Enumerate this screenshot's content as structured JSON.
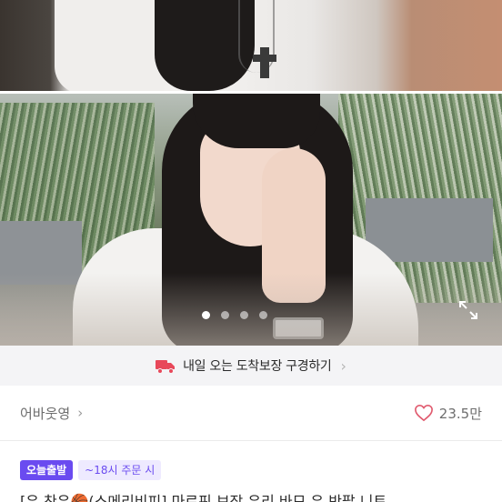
{
  "gallery": {
    "dots_total": 4,
    "dots_active_index": 0,
    "expand_icon": "expand-icon"
  },
  "banner": {
    "icon": "delivery-truck-icon",
    "text": "내일 오는 도착보장 구경하기",
    "chevron": "›",
    "accent_color": "#e8485a"
  },
  "shop": {
    "name": "어바웃영",
    "chevron": "›",
    "likes_icon": "heart-icon",
    "likes_count": "23.5만",
    "heart_color": "#e05a6e"
  },
  "badges": {
    "primary": "오늘출발",
    "secondary": "~18시 주문 시",
    "accent_color": "#6a4bf0"
  },
  "product": {
    "title": "[우 찬우🏀(스메리비피] 마르핀 보장 우리 바모 유 반팔 니트"
  }
}
